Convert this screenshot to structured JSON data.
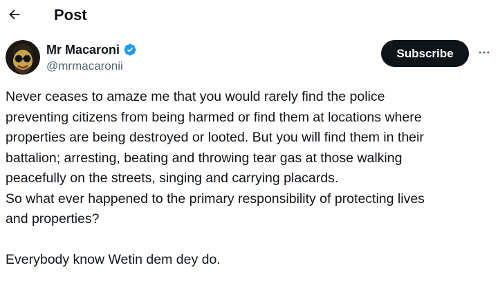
{
  "header": {
    "title": "Post",
    "back_icon": "arrow-left-icon"
  },
  "author": {
    "name": "Mr Macaroni",
    "handle": "@mrmacaronii",
    "verified_icon": "verified-badge-icon",
    "verified_color": "#1d9bf0",
    "avatar_icon": "avatar-image"
  },
  "actions": {
    "subscribe_label": "Subscribe",
    "more_icon": "more-horizontal-icon"
  },
  "tweet": {
    "lines": [
      "Never ceases to amaze me that you would rarely find the police",
      "preventing citizens from being harmed or find them at locations where",
      "properties are being destroyed or looted. But you will find them in their",
      "battalion; arresting, beating and throwing tear gas at those walking",
      "peacefully on the streets, singing and carrying placards.",
      "So what ever happened to the primary responsibility of protecting lives",
      "and properties?",
      "",
      "Everybody know Wetin dem dey do."
    ]
  },
  "colors": {
    "text": "#0f1419",
    "secondary_text": "#536471",
    "button_bg": "#0f1419",
    "button_text": "#ffffff"
  }
}
